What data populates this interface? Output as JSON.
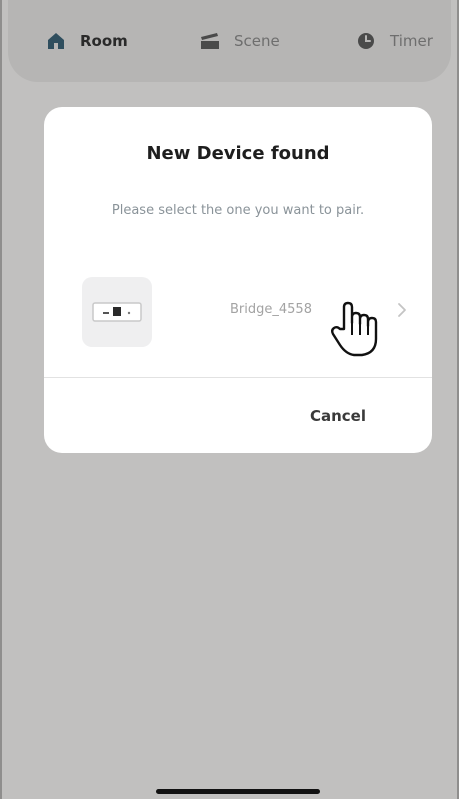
{
  "nav": {
    "items": [
      {
        "label": "Room",
        "icon": "home-icon",
        "active": true
      },
      {
        "label": "Scene",
        "icon": "scene-icon",
        "active": false
      },
      {
        "label": "Timer",
        "icon": "clock-icon",
        "active": false
      }
    ]
  },
  "dialog": {
    "title": "New Device found",
    "subtitle": "Please select the one you want to pair.",
    "device": {
      "name": "Bridge_4558",
      "icon": "bridge-device-icon"
    },
    "cancel_label": "Cancel"
  },
  "colors": {
    "overlay_background": "#c1c0bf",
    "nav_background": "#b6b5b4",
    "home_icon": "#2f4e5e",
    "dialog_background": "#ffffff"
  }
}
